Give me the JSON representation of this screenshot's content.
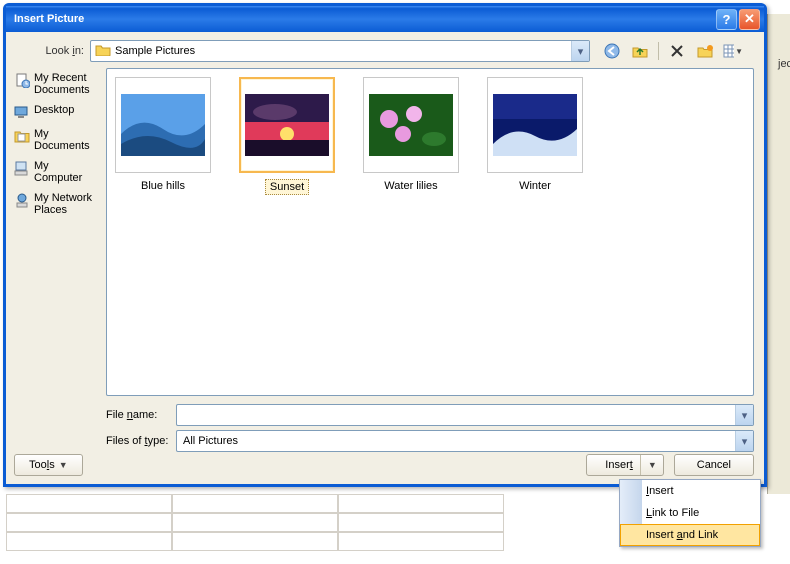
{
  "window": {
    "title": "Insert Picture"
  },
  "lookin": {
    "label": "Look in:",
    "value": "Sample Pictures"
  },
  "places": {
    "items": [
      {
        "label": "My Recent Documents"
      },
      {
        "label": "Desktop"
      },
      {
        "label": "My Documents"
      },
      {
        "label": "My Computer"
      },
      {
        "label": "My Network Places"
      }
    ]
  },
  "files": {
    "items": [
      {
        "label": "Blue hills"
      },
      {
        "label": "Sunset"
      },
      {
        "label": "Water lilies"
      },
      {
        "label": "Winter"
      }
    ],
    "selected_index": 1
  },
  "filename": {
    "label": "File name:",
    "value": ""
  },
  "filetype": {
    "label": "Files of type:",
    "value": "All Pictures"
  },
  "buttons": {
    "tools": "Tools",
    "insert": "Insert",
    "cancel": "Cancel"
  },
  "insert_menu": {
    "items": [
      {
        "label": "Insert"
      },
      {
        "label": "Link to File"
      },
      {
        "label": "Insert and Link"
      }
    ],
    "hover_index": 2
  }
}
